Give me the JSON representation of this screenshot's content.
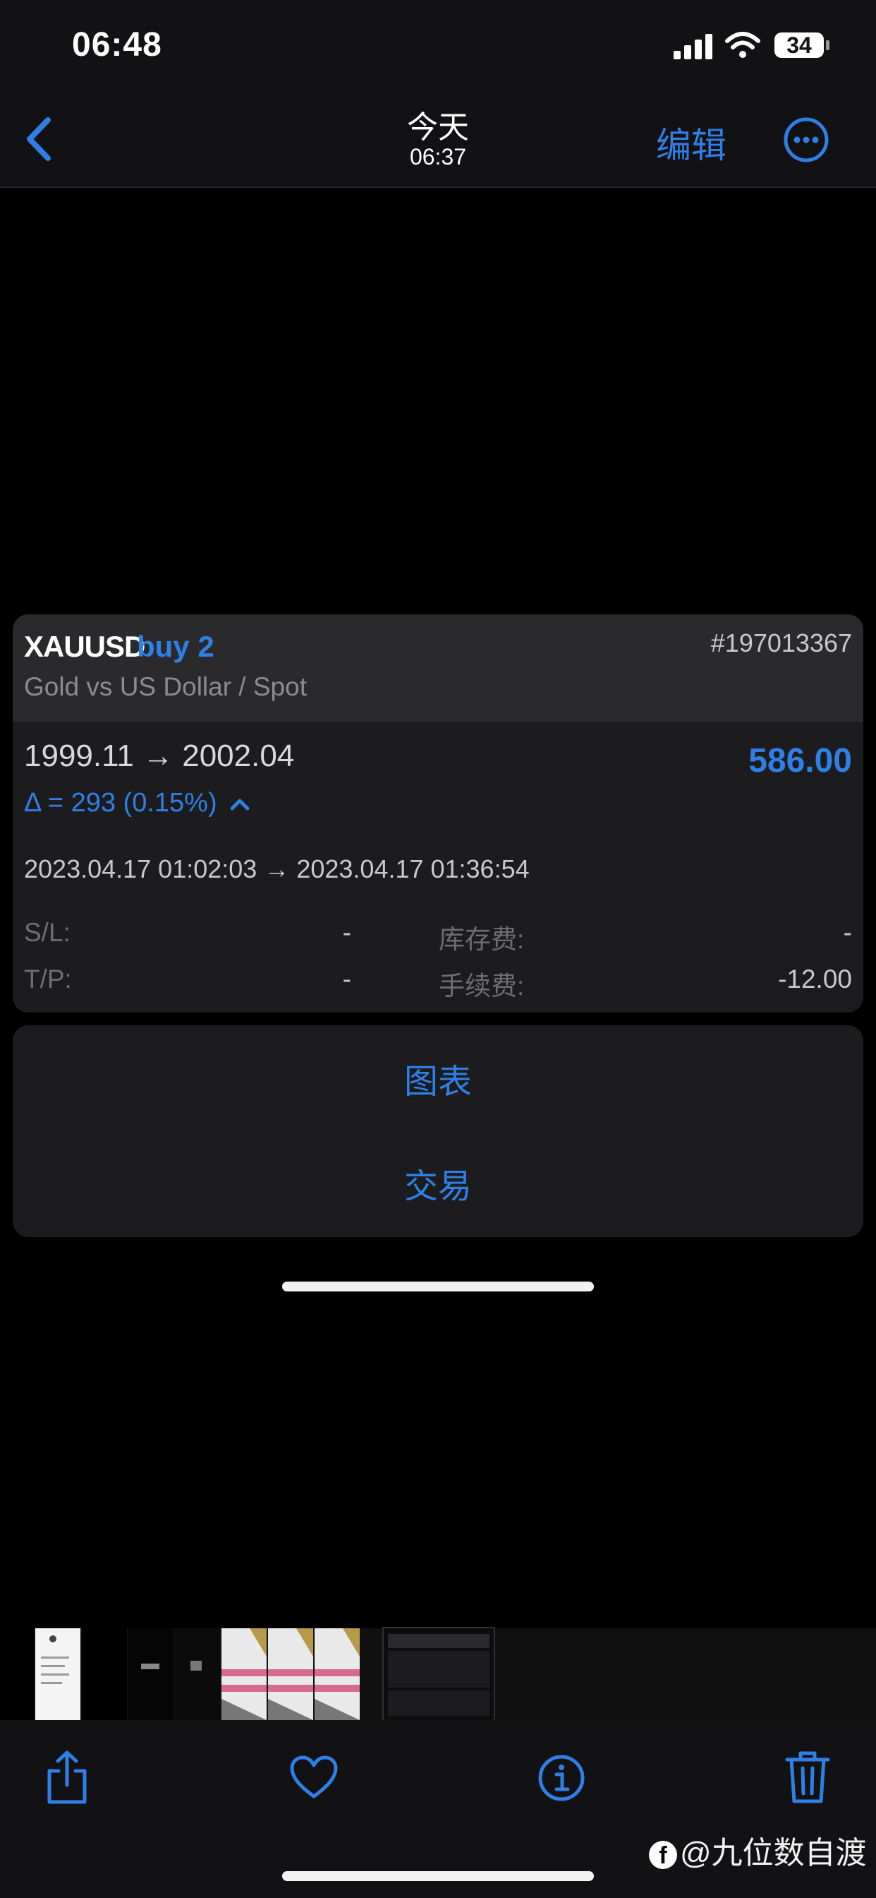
{
  "status_bar": {
    "time": "06:48",
    "battery": "34"
  },
  "nav": {
    "title": "今天",
    "subtitle": "06:37",
    "edit_label": "编辑"
  },
  "trade": {
    "symbol": "XAUUSD",
    "order_type": "buy 2",
    "ticket": "#197013367",
    "description": "Gold vs US Dollar / Spot",
    "prices": "1999.11 → 2002.04",
    "profit": "586.00",
    "delta": "Δ = 293 (0.15%)",
    "times": "2023.04.17 01:02:03 → 2023.04.17 01:36:54",
    "sl_label": "S/L:",
    "sl_value": "-",
    "tp_label": "T/P:",
    "tp_value": "-",
    "swap_label": "库存费:",
    "swap_value": "-",
    "commission_label": "手续费:",
    "commission_value": "-12.00"
  },
  "actions": {
    "chart": "图表",
    "trade": "交易"
  },
  "watermark": {
    "logo": "f",
    "text": "@九位数自渡"
  },
  "colors": {
    "accent": "#2f7fe6",
    "background": "#000000",
    "card": "#1c1c1e",
    "toolbar": "#121214"
  },
  "icons": {
    "back": "chevron-left-icon",
    "more": "ellipsis-circle-icon",
    "share": "share-icon",
    "favorite": "heart-icon",
    "info": "info-circle-icon",
    "delete": "trash-icon"
  }
}
